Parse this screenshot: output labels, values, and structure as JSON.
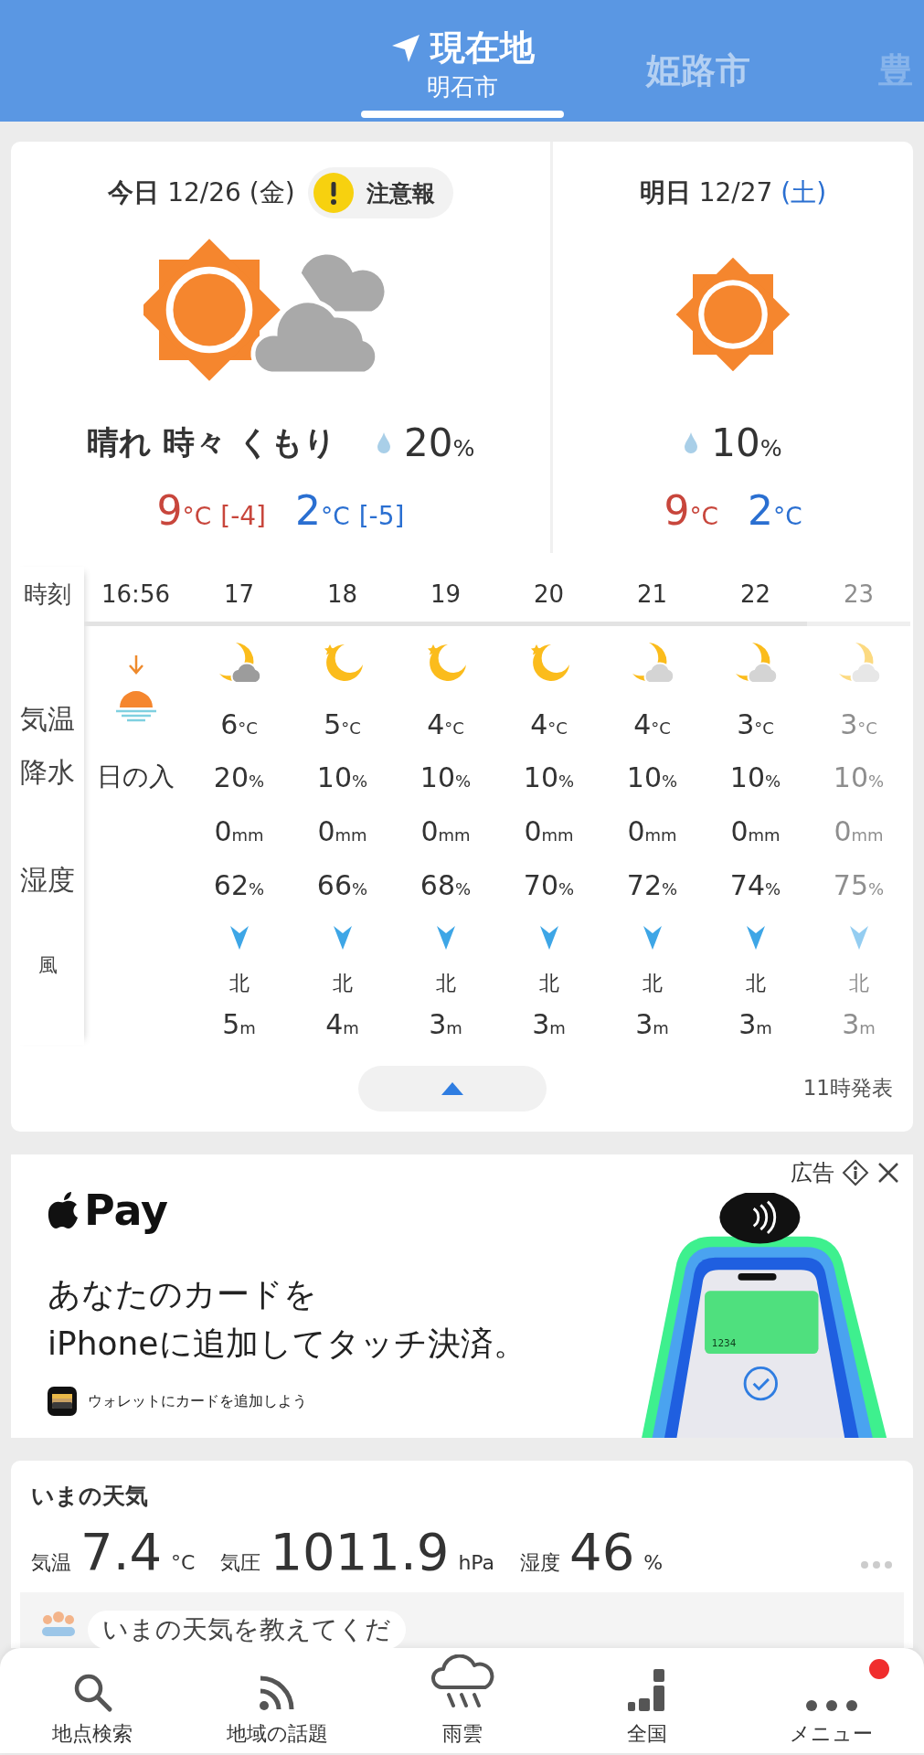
{
  "header": {
    "tabs": [
      {
        "label": "現在地",
        "sublabel": "明石市",
        "kind": "current",
        "selected": true
      },
      {
        "label": "姫路市",
        "kind": "city",
        "selected": false
      },
      {
        "label": "豊",
        "kind": "city",
        "selected": false
      }
    ]
  },
  "days": [
    {
      "day": "今日",
      "date": "12/26",
      "weekday": {
        "text": "(金)",
        "color": "#333333"
      },
      "warning": "注意報",
      "kind": "sun-cloud",
      "weather": "晴れ 時々 くもり",
      "precip": "20",
      "precip_unit": "%",
      "high": "9",
      "high_unit": "°C",
      "high_diff": "[-4]",
      "low": "2",
      "low_unit": "°C",
      "low_diff": "[-5]"
    },
    {
      "day": "明日",
      "date": "12/27",
      "weekday": {
        "text": "(土)",
        "color": "#2a6fd1"
      },
      "kind": "sun",
      "precip": "10",
      "precip_unit": "%",
      "high": "9",
      "high_unit": "°C",
      "low": "2",
      "low_unit": "°C"
    }
  ],
  "hourly": {
    "row_labels": {
      "time": "時刻",
      "temp": "気温",
      "precip": "降水",
      "humidity": "湿度",
      "wind": "風"
    },
    "sunset": {
      "time": "16:56",
      "label": "日の入"
    },
    "hours": [
      {
        "time": "17",
        "kind": "moon-cloud",
        "temp": "6",
        "temp_unit": "°C",
        "precip": "20",
        "precip_unit": "%",
        "rain": "0",
        "rain_unit": "mm",
        "humidity": "62",
        "humidity_unit": "%",
        "wind_dir": "北",
        "wind": "5",
        "wind_unit": "m"
      },
      {
        "time": "18",
        "kind": "moon-star",
        "temp": "5",
        "temp_unit": "°C",
        "precip": "10",
        "precip_unit": "%",
        "rain": "0",
        "rain_unit": "mm",
        "humidity": "66",
        "humidity_unit": "%",
        "wind_dir": "北",
        "wind": "4",
        "wind_unit": "m"
      },
      {
        "time": "19",
        "kind": "moon-star",
        "temp": "4",
        "temp_unit": "°C",
        "precip": "10",
        "precip_unit": "%",
        "rain": "0",
        "rain_unit": "mm",
        "humidity": "68",
        "humidity_unit": "%",
        "wind_dir": "北",
        "wind": "3",
        "wind_unit": "m"
      },
      {
        "time": "20",
        "kind": "moon-star",
        "temp": "4",
        "temp_unit": "°C",
        "precip": "10",
        "precip_unit": "%",
        "rain": "0",
        "rain_unit": "mm",
        "humidity": "70",
        "humidity_unit": "%",
        "wind_dir": "北",
        "wind": "3",
        "wind_unit": "m"
      },
      {
        "time": "21",
        "kind": "moon-light-cloud",
        "temp": "4",
        "temp_unit": "°C",
        "precip": "10",
        "precip_unit": "%",
        "rain": "0",
        "rain_unit": "mm",
        "humidity": "72",
        "humidity_unit": "%",
        "wind_dir": "北",
        "wind": "3",
        "wind_unit": "m"
      },
      {
        "time": "22",
        "kind": "moon-light-cloud",
        "temp": "3",
        "temp_unit": "°C",
        "precip": "10",
        "precip_unit": "%",
        "rain": "0",
        "rain_unit": "mm",
        "humidity": "74",
        "humidity_unit": "%",
        "wind_dir": "北",
        "wind": "3",
        "wind_unit": "m"
      },
      {
        "time": "23",
        "kind": "moon-light-cloud",
        "temp": "3",
        "temp_unit": "°C",
        "precip": "10",
        "precip_unit": "%",
        "rain": "0",
        "rain_unit": "mm",
        "humidity": "75",
        "humidity_unit": "%",
        "wind_dir": "北",
        "wind": "3",
        "wind_unit": "m"
      }
    ],
    "issued": "11時発表"
  },
  "ad": {
    "label": "広告",
    "brand": "Pay",
    "headline": [
      "あなたのカードを",
      "iPhoneに追加してタッチ決済。"
    ],
    "cta": "ウォレットにカードを追加しよう",
    "card_number": "1234"
  },
  "now": {
    "title": "いまの天気",
    "readings": [
      {
        "label": "気温",
        "value": "7.4",
        "unit": "°C"
      },
      {
        "label": "気圧",
        "value": "1011.9",
        "unit": "hPa"
      },
      {
        "label": "湿度",
        "value": "46",
        "unit": "%"
      }
    ],
    "prompt": "いまの天気を教えてくだ"
  },
  "nav": [
    {
      "label": "地点検索",
      "kind": "search",
      "badge": false
    },
    {
      "label": "地域の話題",
      "kind": "feed",
      "badge": false
    },
    {
      "label": "雨雲",
      "kind": "rain",
      "badge": false
    },
    {
      "label": "全国",
      "kind": "map",
      "badge": false
    },
    {
      "label": "メニュー",
      "kind": "menu",
      "badge": true
    }
  ]
}
